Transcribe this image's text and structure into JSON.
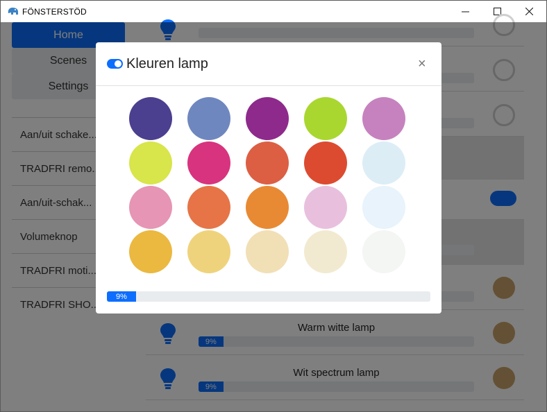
{
  "window": {
    "title": "FÖNSTERSTÖD",
    "minimize_glyph": "—",
    "maximize_glyph": "☐",
    "close_glyph": "✕"
  },
  "nav": {
    "home": "Home",
    "scenes": "Scenes",
    "settings": "Settings"
  },
  "devices": [
    "Aan/uit schake...",
    "TRADFRI remo...",
    "Aan/uit-schak...",
    "Volumeknop",
    "TRADFRI moti...",
    "TRADFRI SHO..."
  ],
  "lamps": [
    {
      "name": "Warm witte lamp",
      "brightness_label": "9%",
      "brightness": 9,
      "color": "#c8a26a"
    },
    {
      "name": "Wit spectrum lamp",
      "brightness_label": "9%",
      "brightness": 9,
      "color": "#c8a26a"
    }
  ],
  "modal": {
    "title": "Kleuren lamp",
    "close_glyph": "×",
    "toggle_on": true,
    "brightness_label": "9%",
    "brightness": 9,
    "colors": [
      "#4b3f8f",
      "#6f87bf",
      "#8e2a8b",
      "#a9d730",
      "#c682be",
      "#d8e54b",
      "#d8337e",
      "#dc5f44",
      "#dc4b30",
      "#dcedf6",
      "#e695b4",
      "#e67446",
      "#e88a33",
      "#e8c0dd",
      "#e8f3fb",
      "#ebb840",
      "#efd37c",
      "#f1dfb6",
      "#f2ead0",
      "#f3f6f3"
    ]
  },
  "colors": {
    "accent": "#0d6efd"
  }
}
